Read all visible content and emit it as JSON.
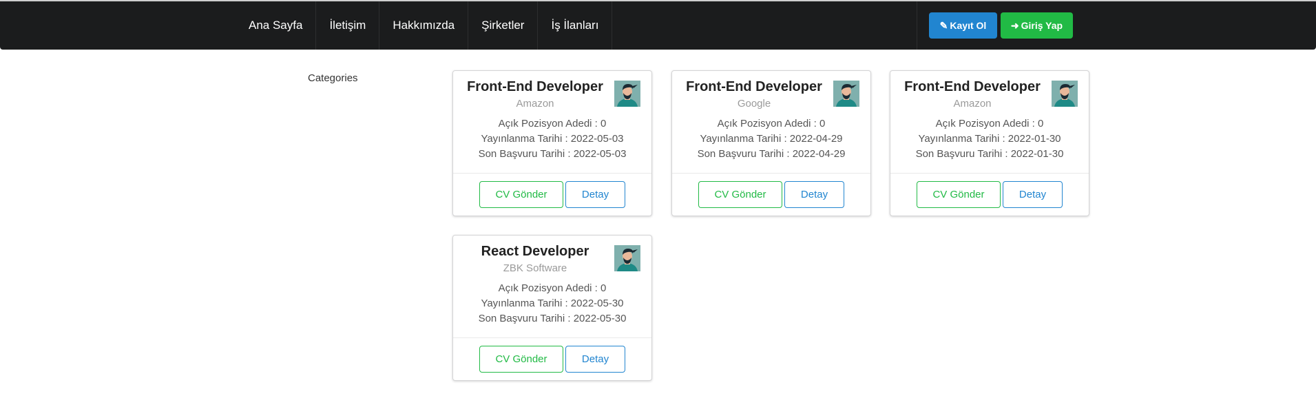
{
  "nav": {
    "items": [
      {
        "label": "Ana Sayfa"
      },
      {
        "label": "İletişim"
      },
      {
        "label": "Hakkımızda"
      },
      {
        "label": "Şirketler"
      },
      {
        "label": "İş İlanları"
      }
    ],
    "register_label": "Kayıt Ol",
    "login_label": "Giriş Yap"
  },
  "sidebar": {
    "title": "Categories"
  },
  "jobs": [
    {
      "title": "Front-End Developer",
      "company": "Amazon",
      "open_positions": "Açık Pozisyon Adedi : 0",
      "published": "Yayınlanma Tarihi : 2022-05-03",
      "deadline": "Son Başvuru Tarihi : 2022-05-03",
      "cv_label": "CV Gönder",
      "detail_label": "Detay"
    },
    {
      "title": "Front-End Developer",
      "company": "Google",
      "open_positions": "Açık Pozisyon Adedi : 0",
      "published": "Yayınlanma Tarihi : 2022-04-29",
      "deadline": "Son Başvuru Tarihi : 2022-04-29",
      "cv_label": "CV Gönder",
      "detail_label": "Detay"
    },
    {
      "title": "Front-End Developer",
      "company": "Amazon",
      "open_positions": "Açık Pozisyon Adedi : 0",
      "published": "Yayınlanma Tarihi : 2022-01-30",
      "deadline": "Son Başvuru Tarihi : 2022-01-30",
      "cv_label": "CV Gönder",
      "detail_label": "Detay"
    },
    {
      "title": "React Developer",
      "company": "ZBK Software",
      "open_positions": "Açık Pozisyon Adedi : 0",
      "published": "Yayınlanma Tarihi : 2022-05-30",
      "deadline": "Son Başvuru Tarihi : 2022-05-30",
      "cv_label": "CV Gönder",
      "detail_label": "Detay"
    }
  ],
  "icons": {
    "register": "edit-icon",
    "login": "sign-in-icon",
    "avatar": "user-avatar"
  },
  "colors": {
    "navbar": "#1b1c1d",
    "primary": "#2185d0",
    "success": "#21ba45"
  }
}
